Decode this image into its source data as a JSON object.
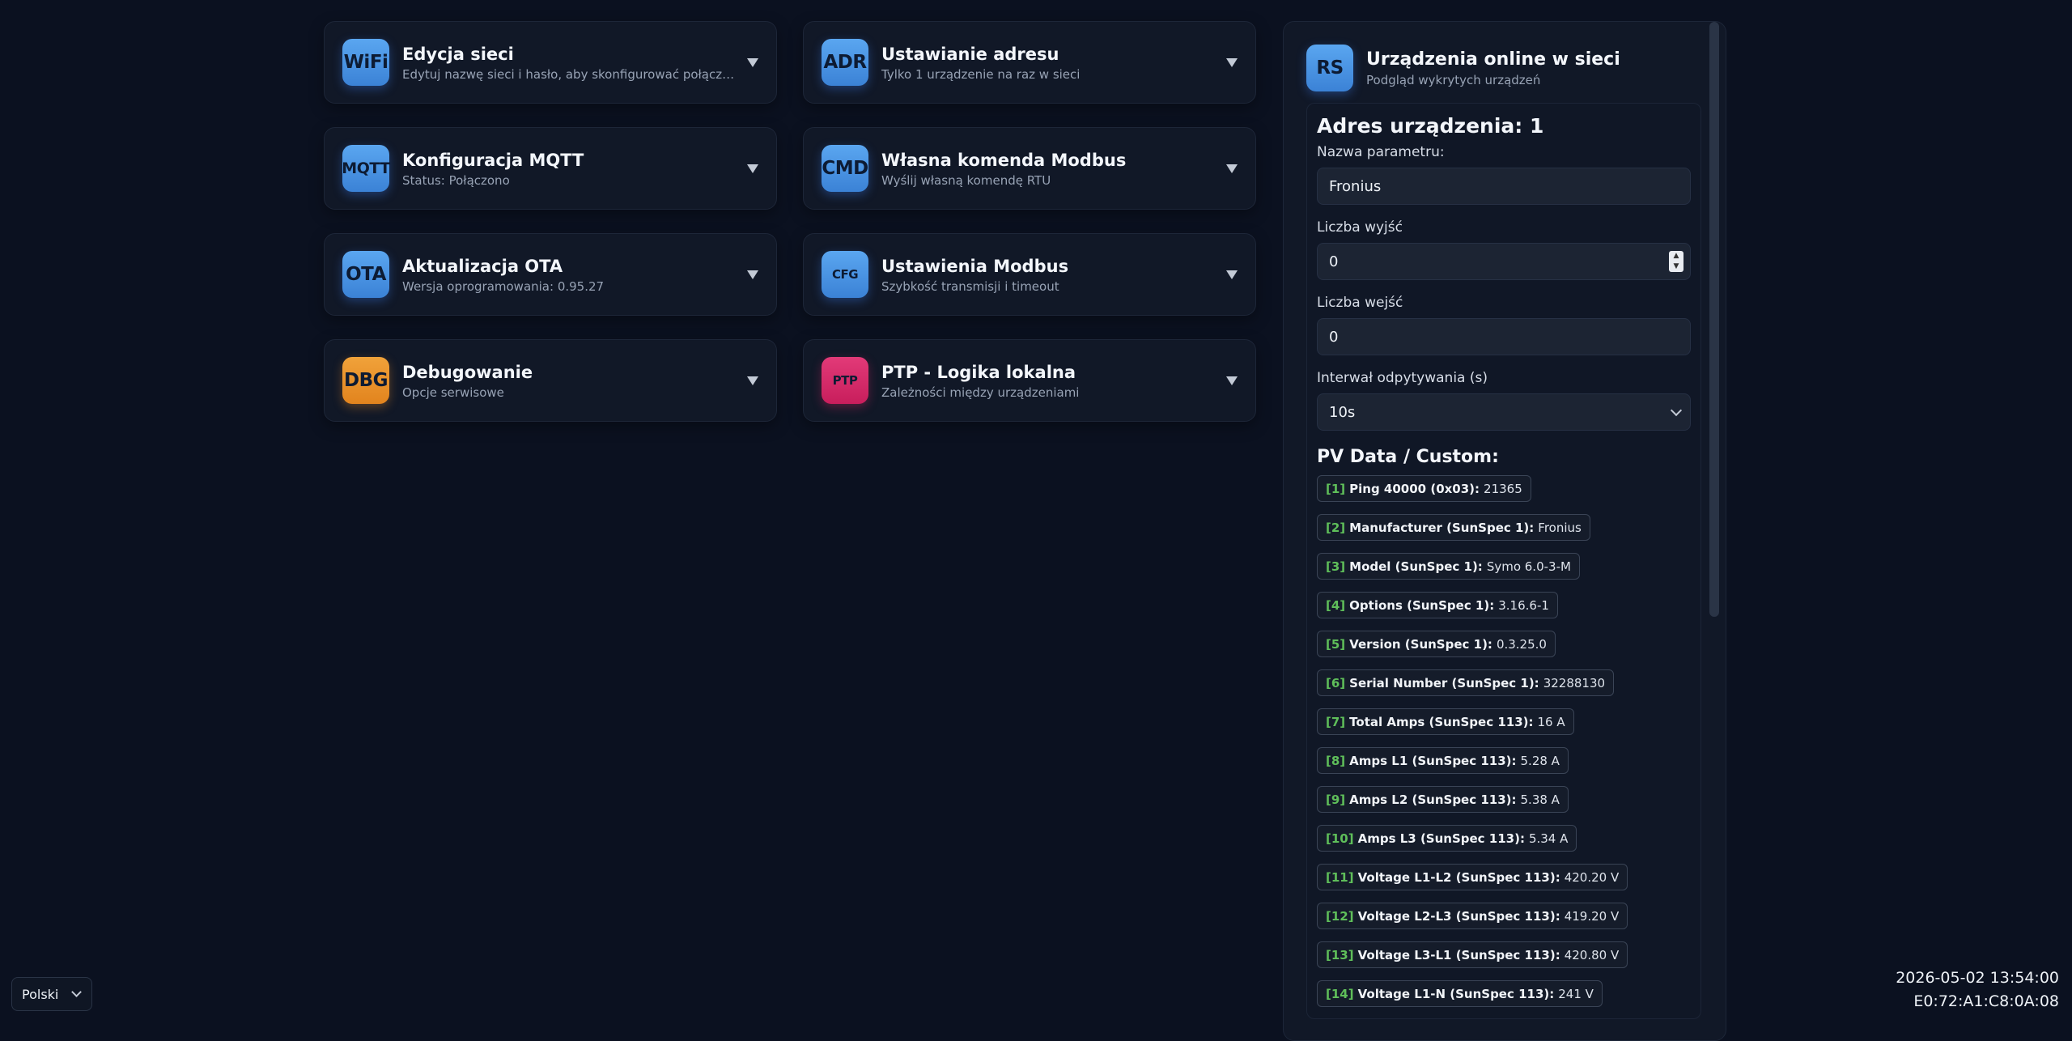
{
  "cards": [
    {
      "badge": "WiFi",
      "title": "Edycja sieci",
      "subtitle": "Edytuj nazwę sieci i hasło, aby skonfigurować połączenie"
    },
    {
      "badge": "MQTT",
      "title": "Konfiguracja MQTT",
      "subtitle": "Status: Połączono"
    },
    {
      "badge": "OTA",
      "title": "Aktualizacja OTA",
      "subtitle": "Wersja oprogramowania: 0.95.27"
    },
    {
      "badge": "DBG",
      "title": "Debugowanie",
      "subtitle": "Opcje serwisowe"
    },
    {
      "badge": "ADR",
      "title": "Ustawianie adresu",
      "subtitle": "Tylko 1 urządzenie na raz w sieci"
    },
    {
      "badge": "CMD",
      "title": "Własna komenda Modbus",
      "subtitle": "Wyślij własną komendę RTU"
    },
    {
      "badge": "CFG",
      "title": "Ustawienia Modbus",
      "subtitle": "Szybkość transmisji i timeout"
    },
    {
      "badge": "PTP",
      "title": "PTP - Logika lokalna",
      "subtitle": "Zależności między urządzeniami"
    }
  ],
  "panel": {
    "badge": "RS",
    "title": "Urządzenia online w sieci",
    "subtitle": "Podgląd wykrytych urządzeń",
    "device": {
      "title": "Adres urządzenia: 1",
      "name_label": "Nazwa parametru:",
      "name_value": "Fronius",
      "outputs_label": "Liczba wyjść",
      "outputs_value": "0",
      "inputs_label": "Liczba wejść",
      "inputs_value": "0",
      "interval_label": "Interwał odpytywania (s)",
      "interval_value": "10s",
      "section_title": "PV Data / Custom:",
      "items": [
        {
          "idx": "[1]",
          "key": "Ping 40000 (0x03):",
          "val": "21365"
        },
        {
          "idx": "[2]",
          "key": "Manufacturer (SunSpec 1):",
          "val": "Fronius"
        },
        {
          "idx": "[3]",
          "key": "Model (SunSpec 1):",
          "val": "Symo 6.0-3-M"
        },
        {
          "idx": "[4]",
          "key": "Options (SunSpec 1):",
          "val": "3.16.6-1"
        },
        {
          "idx": "[5]",
          "key": "Version (SunSpec 1):",
          "val": "0.3.25.0"
        },
        {
          "idx": "[6]",
          "key": "Serial Number (SunSpec 1):",
          "val": "32288130"
        },
        {
          "idx": "[7]",
          "key": "Total Amps (SunSpec 113):",
          "val": "16 A"
        },
        {
          "idx": "[8]",
          "key": "Amps L1 (SunSpec 113):",
          "val": "5.28 A"
        },
        {
          "idx": "[9]",
          "key": "Amps L2 (SunSpec 113):",
          "val": "5.38 A"
        },
        {
          "idx": "[10]",
          "key": "Amps L3 (SunSpec 113):",
          "val": "5.34 A"
        },
        {
          "idx": "[11]",
          "key": "Voltage L1-L2 (SunSpec 113):",
          "val": "420.20 V"
        },
        {
          "idx": "[12]",
          "key": "Voltage L2-L3 (SunSpec 113):",
          "val": "419.20 V"
        },
        {
          "idx": "[13]",
          "key": "Voltage L3-L1 (SunSpec 113):",
          "val": "420.80 V"
        },
        {
          "idx": "[14]",
          "key": "Voltage L1-N (SunSpec 113):",
          "val": "241 V"
        }
      ]
    }
  },
  "footer": {
    "language": "Polski",
    "datetime": "2026-05-02 13:54:00",
    "mac": "E0:72:A1:C8:0A:08"
  }
}
